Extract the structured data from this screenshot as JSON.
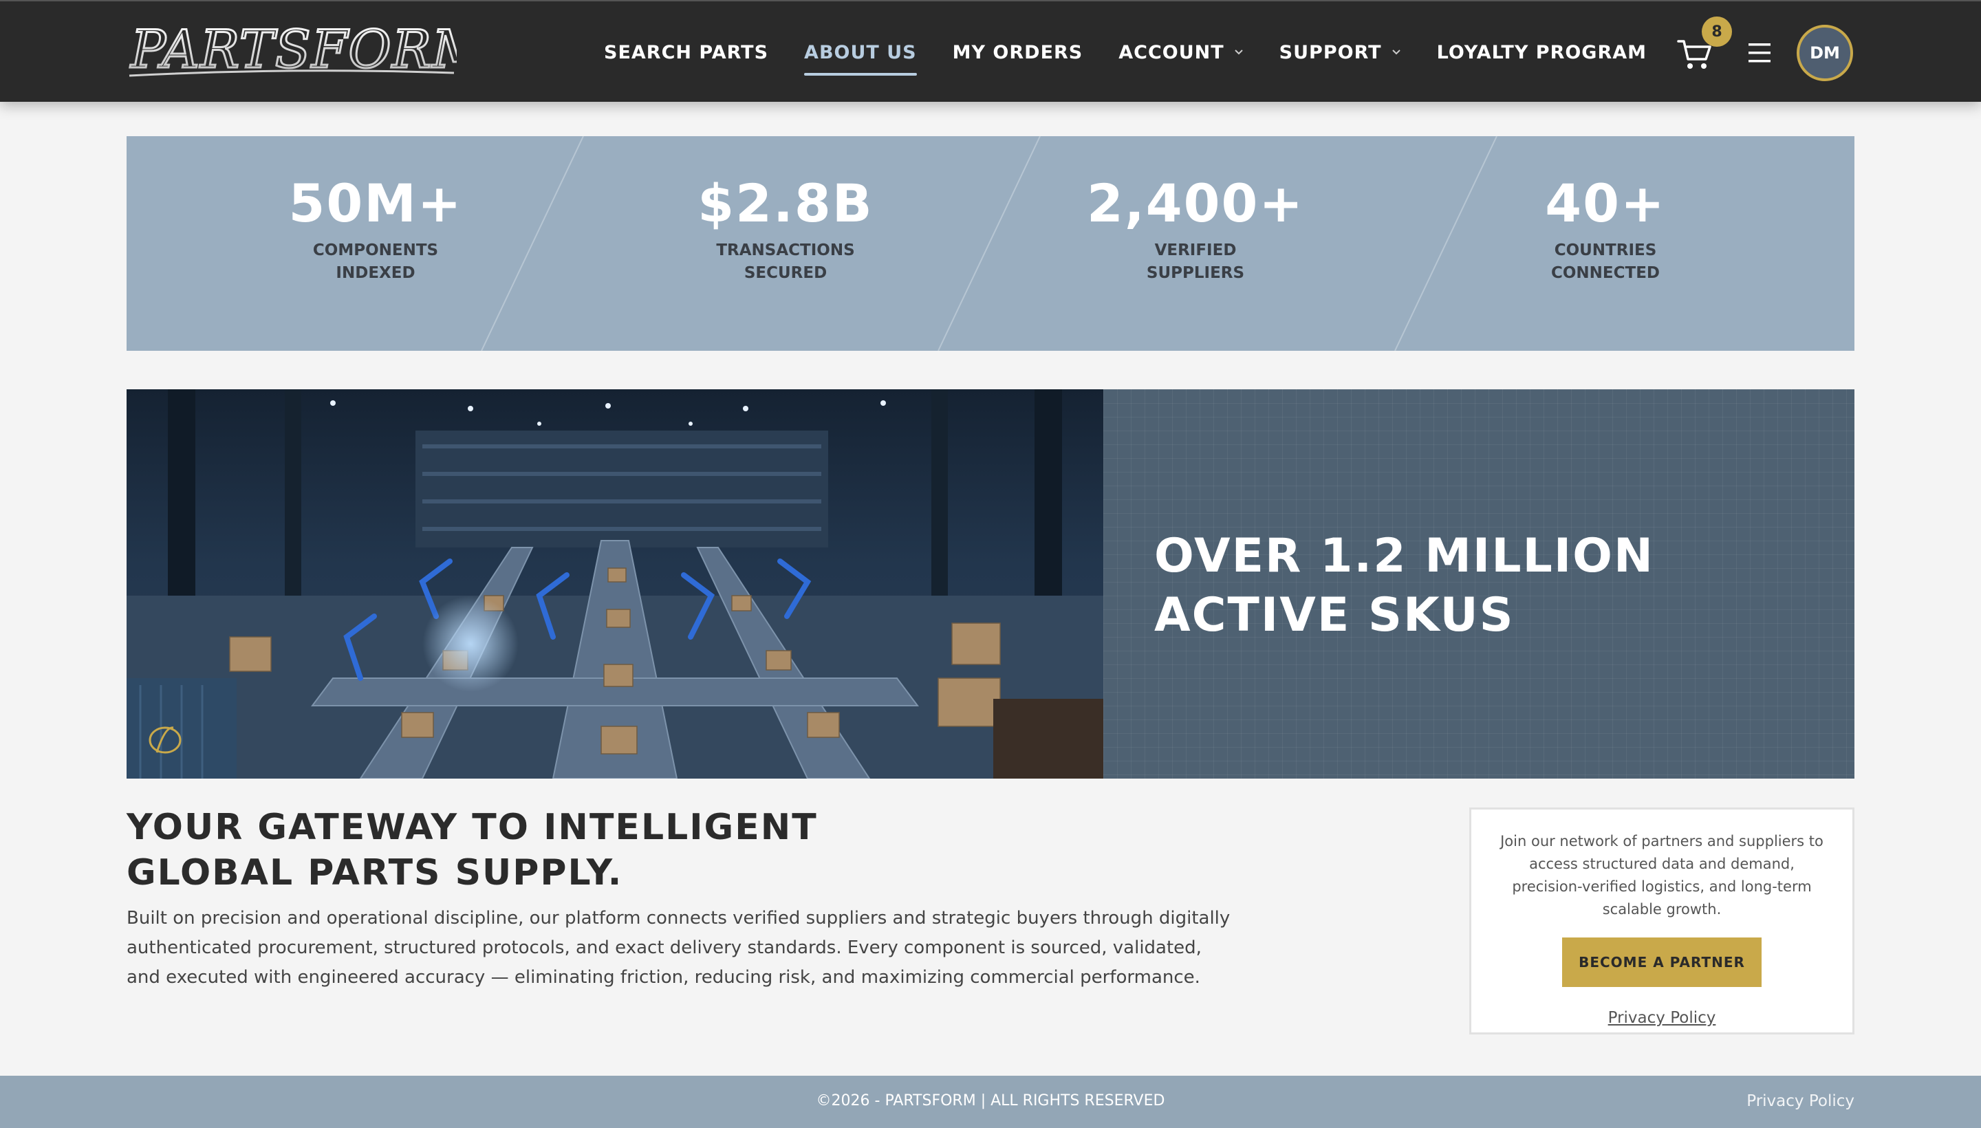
{
  "header": {
    "logo_text": "PARTSFORM",
    "nav": [
      {
        "label": "SEARCH PARTS",
        "active": false,
        "has_dropdown": false
      },
      {
        "label": "ABOUT US",
        "active": true,
        "has_dropdown": false
      },
      {
        "label": "MY ORDERS",
        "active": false,
        "has_dropdown": false
      },
      {
        "label": "ACCOUNT",
        "active": false,
        "has_dropdown": true
      },
      {
        "label": "SUPPORT",
        "active": false,
        "has_dropdown": true
      },
      {
        "label": "LOYALTY PROGRAM",
        "active": false,
        "has_dropdown": false
      }
    ],
    "cart_count": "8",
    "avatar_initials": "DM"
  },
  "stats": [
    {
      "value": "50M+",
      "label_line1": "COMPONENTS",
      "label_line2": "INDEXED"
    },
    {
      "value": "$2.8B",
      "label_line1": "TRANSACTIONS",
      "label_line2": "SECURED"
    },
    {
      "value": "2,400+",
      "label_line1": "VERIFIED",
      "label_line2": "SUPPLIERS"
    },
    {
      "value": "40+",
      "label_line1": "COUNTRIES",
      "label_line2": "CONNECTED"
    }
  ],
  "hero": {
    "title_line1": "OVER 1.2 MILLION",
    "title_line2": "ACTIVE SKUS"
  },
  "intro": {
    "title_line1": "YOUR GATEWAY TO INTELLIGENT",
    "title_line2": "GLOBAL PARTS SUPPLY.",
    "body": "Built on precision and operational discipline, our platform connects verified suppliers and strategic buyers through digitally authenticated procurement, structured protocols, and exact delivery standards. Every component is sourced, validated, and executed with engineered accuracy — eliminating friction, reducing risk, and maximizing commercial performance."
  },
  "partner_card": {
    "text": "Join our network of partners and suppliers to access structured data and demand, precision-verified logistics, and long-term scalable growth.",
    "button_label": "BECOME A PARTNER",
    "privacy_link": "Privacy Policy"
  },
  "footer": {
    "copyright": "©2026 - PARTSFORM | ALL RIGHTS RESERVED",
    "privacy_link": "Privacy Policy"
  },
  "colors": {
    "header_bg": "#2a2a2a",
    "accent_gold": "#c9a94a",
    "stats_bg": "#9aaec0",
    "hero_panel_bg": "#4e6172",
    "footer_bg": "#93a6b6"
  },
  "icons": [
    "cart-icon",
    "hamburger-menu-icon",
    "chevron-down-icon",
    "logo-mark-icon"
  ]
}
